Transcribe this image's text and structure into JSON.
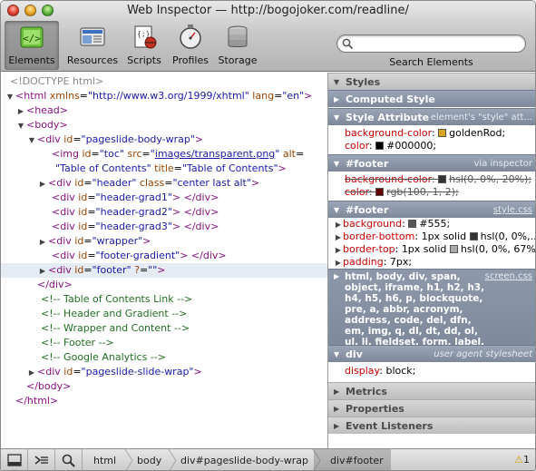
{
  "window": {
    "title": "Web Inspector — http://bogojoker.com/readline/"
  },
  "toolbar": {
    "items": [
      {
        "label": "Elements",
        "icon": "elements-icon",
        "selected": true
      },
      {
        "label": "Resources",
        "icon": "resources-icon"
      },
      {
        "label": "Scripts",
        "icon": "scripts-icon"
      },
      {
        "label": "Profiles",
        "icon": "profiles-icon"
      },
      {
        "label": "Storage",
        "icon": "storage-icon"
      }
    ],
    "search": {
      "placeholder": "",
      "value": "",
      "label": "Search Elements"
    }
  },
  "dom_tree": {
    "doctype": "<!DOCTYPE html>",
    "html_open": {
      "tag": "<html",
      "attrs": [
        {
          "name": "xmlns",
          "value": "\"http://www.w3.org/1999/xhtml\""
        },
        {
          "name": "lang",
          "value": "\"en\""
        }
      ]
    },
    "head": "<head>",
    "body": "<body>",
    "wrap": {
      "tag": "<div",
      "name": "id",
      "value": "\"pageslide-body-wrap\"",
      "close": ">"
    },
    "img": {
      "tag": "<img",
      "a1": "id",
      "v1": "\"toc\"",
      "a2": "src",
      "v2": "images/transparent.png",
      "a3": "alt",
      "v3": "\"Table of Contents\"",
      "a4": "title",
      "v4": "\"Table of Contents\"",
      "close": ">"
    },
    "divs": [
      {
        "open": "<div",
        "name": "id",
        "value": "\"header\"",
        "extra_name": "class",
        "extra_value": "\"center last alt\"",
        "close": ">",
        "end": ""
      },
      {
        "open": "<div",
        "name": "id",
        "value": "\"header-grad1\"",
        "close": ">",
        "end": "</div>"
      },
      {
        "open": "<div",
        "name": "id",
        "value": "\"header-grad2\"",
        "close": ">",
        "end": "</div>"
      },
      {
        "open": "<div",
        "name": "id",
        "value": "\"header-grad3\"",
        "close": ">",
        "end": "</div>"
      },
      {
        "open": "<div",
        "name": "id",
        "value": "\"wrapper\"",
        "close": ">",
        "end": ""
      },
      {
        "open": "<div",
        "name": "id",
        "value": "\"footer-gradient\"",
        "close": ">",
        "end": "</div>"
      },
      {
        "open": "<div",
        "name": "id",
        "value": "\"footer\"",
        "extra_name": "?",
        "extra_value": "\"\"",
        "close": ">",
        "end": ""
      }
    ],
    "close_div": "</div>",
    "comments": [
      "<!-- Table of Contents Link -->",
      "<!-- Header and Gradient -->",
      "<!-- Wrapper and Content -->",
      "<!-- Footer -->",
      "<!-- Google Analytics -->"
    ],
    "slide": {
      "open": "<div",
      "name": "id",
      "value": "\"pageslide-slide-wrap\"",
      "close": ">"
    },
    "close_body": "</body>",
    "close_html": "</html>"
  },
  "styles": {
    "header": "Styles",
    "computed": "Computed Style",
    "attr": {
      "title": "Style Attribute",
      "source": "element's \"style\" att...",
      "props": [
        {
          "name": "background-color",
          "value": "goldenRod;",
          "swatch": "#daa520"
        },
        {
          "name": "color",
          "value": "#000000;",
          "swatch": "#000000"
        }
      ]
    },
    "inspector": {
      "title": "#footer",
      "source": "via inspector",
      "props": [
        {
          "name": "background-color",
          "value": "hsl(0, 0%, 20%);",
          "swatch": "#333333"
        },
        {
          "name": "color",
          "value": "rgb(100, 1, 2);",
          "swatch": "#640102"
        }
      ]
    },
    "css": {
      "title": "#footer",
      "source": "style.css",
      "props": [
        {
          "name": "background",
          "value": "#555;",
          "swatch": "#555555"
        },
        {
          "name": "border-bottom",
          "value": "1px solid",
          "tail": "hsl(0, 0%,...",
          "swatch": "#333333"
        },
        {
          "name": "border-top",
          "value": "1px solid",
          "tail": "hsl(0, 0%, 67%);",
          "swatch": "#aaaaaa"
        },
        {
          "name": "padding",
          "value": "7px;"
        }
      ]
    },
    "screen": {
      "selector": "html, body, div, span, object, iframe, h1, h2, h3, h4, h5, h6, p, blockquote, pre, a, abbr, acronym, address, code, del, dfn, em, img, q, dl, dt, dd, ol, ul, li, fieldset, form, label, legend, table, caption, tbody, tfoot, thead, tr, th, td",
      "source": "screen.css"
    },
    "ua": {
      "title": "div",
      "source": "user agent stylesheet",
      "props": [
        {
          "name": "display",
          "value": "block;"
        }
      ]
    }
  },
  "panes": [
    "Metrics",
    "Properties",
    "Event Listeners"
  ],
  "statusbar": {
    "crumbs": [
      "html",
      "body",
      "div#pageslide-body-wrap",
      "div#footer"
    ],
    "warnings": "1",
    "warn_symbol": "⚠"
  }
}
